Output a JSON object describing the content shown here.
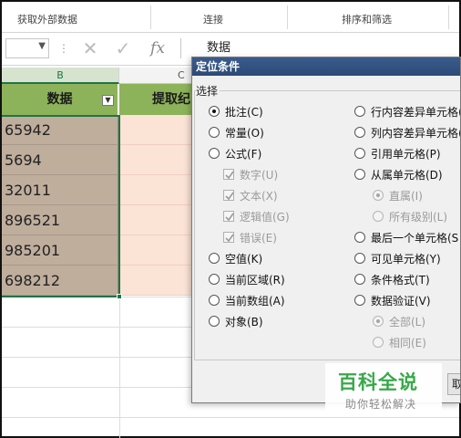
{
  "ribbon": {
    "groups": [
      "获取外部数据",
      "连接",
      "排序和筛选"
    ]
  },
  "formula_bar": {
    "name_box_value": "",
    "dots_icon": "more-dots-icon",
    "cancel_icon": "cancel-x-icon",
    "enter_icon": "checkmark-icon",
    "fx_label": "fx",
    "content": "数据"
  },
  "sheet": {
    "columns": [
      "B",
      "C"
    ],
    "header": {
      "b": "数据",
      "c": "提取纪"
    },
    "filter_icon": "filter-dropdown-icon",
    "rows": [
      "65942",
      "5694",
      "32011",
      "896521",
      "985201",
      "698212"
    ],
    "colors": {
      "header_fill": "#8db35a",
      "data_fill": "#c0ae9d",
      "c_fill": "#fbe3d6",
      "selection": "#217346"
    }
  },
  "dialog": {
    "title": "定位条件",
    "group_label": "选择",
    "left_options": [
      {
        "label": "批注(C)",
        "selected": true
      },
      {
        "label": "常量(O)",
        "selected": false
      },
      {
        "label": "公式(F)",
        "selected": false
      },
      {
        "label": "空值(K)",
        "selected": false
      },
      {
        "label": "当前区域(R)",
        "selected": false
      },
      {
        "label": "当前数组(A)",
        "selected": false
      },
      {
        "label": "对象(B)",
        "selected": false
      }
    ],
    "formula_checks": [
      {
        "label": "数字(U)",
        "checked": true
      },
      {
        "label": "文本(X)",
        "checked": true
      },
      {
        "label": "逻辑值(G)",
        "checked": true
      },
      {
        "label": "错误(E)",
        "checked": true
      }
    ],
    "right_options": [
      {
        "label": "行内容差异单元格(",
        "selected": false
      },
      {
        "label": "列内容差异单元格(",
        "selected": false
      },
      {
        "label": "引用单元格(P)",
        "selected": false
      },
      {
        "label": "从属单元格(D)",
        "selected": false
      },
      {
        "label": "最后一个单元格(S",
        "selected": false
      },
      {
        "label": "可见单元格(Y)",
        "selected": false
      },
      {
        "label": "条件格式(T)",
        "selected": false
      },
      {
        "label": "数据验证(V)",
        "selected": false
      }
    ],
    "dependents_sub": [
      {
        "label": "直属(I)",
        "selected": true
      },
      {
        "label": "所有级别(L)",
        "selected": false
      }
    ],
    "validation_sub": [
      {
        "label": "全部(L)",
        "selected": true
      },
      {
        "label": "相同(E)",
        "selected": false
      }
    ],
    "ok_button_partial": "取"
  },
  "watermark": {
    "title": "百科全说",
    "subtitle": "助你轻松解决",
    "color": "#38a94a"
  }
}
